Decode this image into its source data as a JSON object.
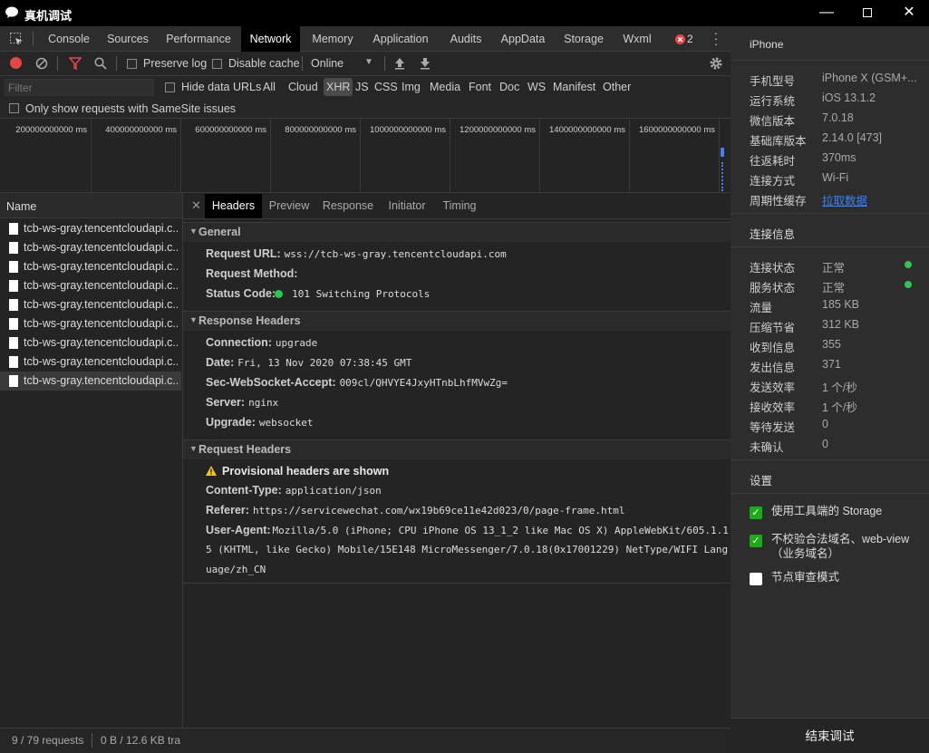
{
  "window": {
    "title": "真机调试"
  },
  "tabs": [
    "Console",
    "Sources",
    "Performance",
    "Network",
    "Memory",
    "Application",
    "Audits",
    "AppData",
    "Storage",
    "Wxml"
  ],
  "error_count": "2",
  "toolbar": {
    "preserve_log": "Preserve log",
    "disable_cache": "Disable cache",
    "throttle": "Online"
  },
  "filter": {
    "placeholder": "Filter",
    "hide_data_urls": "Hide data URLs",
    "types": [
      "All",
      "Cloud",
      "XHR",
      "JS",
      "CSS",
      "Img",
      "Media",
      "Font",
      "Doc",
      "WS",
      "Manifest",
      "Other"
    ],
    "samesite": "Only show requests with SameSite issues"
  },
  "timeline": {
    "ticks": [
      "200000000000 ms",
      "400000000000 ms",
      "600000000000 ms",
      "800000000000 ms",
      "1000000000000 ms",
      "1200000000000 ms",
      "1400000000000 ms",
      "1600000000000 ms"
    ]
  },
  "requests": {
    "header": "Name",
    "items": [
      "tcb-ws-gray.tencentcloudapi.c...",
      "tcb-ws-gray.tencentcloudapi.c...",
      "tcb-ws-gray.tencentcloudapi.c...",
      "tcb-ws-gray.tencentcloudapi.c...",
      "tcb-ws-gray.tencentcloudapi.c...",
      "tcb-ws-gray.tencentcloudapi.c...",
      "tcb-ws-gray.tencentcloudapi.c...",
      "tcb-ws-gray.tencentcloudapi.c...",
      "tcb-ws-gray.tencentcloudapi.c..."
    ]
  },
  "status": {
    "requests": "9 / 79 requests",
    "transferred": "0 B / 12.6 KB tra"
  },
  "detail": {
    "tabs": [
      "Headers",
      "Preview",
      "Response",
      "Initiator",
      "Timing"
    ],
    "general": {
      "title": "General",
      "request_url_label": "Request URL:",
      "request_url": "wss://tcb-ws-gray.tencentcloudapi.com",
      "request_method_label": "Request Method:",
      "status_code_label": "Status Code:",
      "status_code": "101 Switching Protocols"
    },
    "response_headers": {
      "title": "Response Headers",
      "items": [
        {
          "k": "Connection:",
          "v": "upgrade"
        },
        {
          "k": "Date:",
          "v": "Fri, 13 Nov 2020 07:38:45 GMT"
        },
        {
          "k": "Sec-WebSocket-Accept:",
          "v": "009cl/QHVYE4JxyHTnbLhfMVwZg="
        },
        {
          "k": "Server:",
          "v": "nginx"
        },
        {
          "k": "Upgrade:",
          "v": "websocket"
        }
      ]
    },
    "request_headers": {
      "title": "Request Headers",
      "warning": "Provisional headers are shown",
      "content_type_label": "Content-Type:",
      "content_type": "application/json",
      "referer_label": "Referer:",
      "referer": "https://servicewechat.com/wx19b69ce11e42d023/0/page-frame.html",
      "ua_label": "User-Agent:",
      "ua_line1": "Mozilla/5.0 (iPhone; CPU iPhone OS 13_1_2 like Mac OS X) AppleWebKit/605.1.1",
      "ua_line2": "5 (KHTML, like Gecko) Mobile/15E148 MicroMessenger/7.0.18(0x17001229) NetType/WIFI Lang",
      "ua_line3": "uage/zh_CN"
    }
  },
  "side": {
    "device_title": "iPhone",
    "device": [
      {
        "k": "手机型号",
        "v": "iPhone X (GSM+..."
      },
      {
        "k": "运行系统",
        "v": "iOS 13.1.2"
      },
      {
        "k": "微信版本",
        "v": "7.0.18"
      },
      {
        "k": "基础库版本",
        "v": "2.14.0 [473]"
      },
      {
        "k": "往返耗时",
        "v": "370ms"
      },
      {
        "k": "连接方式",
        "v": "Wi-Fi"
      },
      {
        "k": "周期性缓存",
        "v": "拉取数据"
      }
    ],
    "conn_title": "连接信息",
    "conn": [
      {
        "k": "连接状态",
        "v": "正常"
      },
      {
        "k": "服务状态",
        "v": "正常"
      },
      {
        "k": "流量",
        "v": "185 KB"
      },
      {
        "k": "压缩节省",
        "v": "312 KB"
      },
      {
        "k": "收到信息",
        "v": "355"
      },
      {
        "k": "发出信息",
        "v": "371"
      },
      {
        "k": "发送效率",
        "v": "1 个/秒"
      },
      {
        "k": "接收效率",
        "v": "1 个/秒"
      },
      {
        "k": "等待发送",
        "v": "0"
      },
      {
        "k": "未确认",
        "v": "0"
      }
    ],
    "settings_title": "设置",
    "settings": [
      "使用工具端的 Storage",
      "不校验合法域名、web-view（业务域名）",
      "节点审查模式"
    ],
    "end_button": "结束调试"
  },
  "colors": {
    "accent_green": "#1aad19",
    "status_green": "#2dc653",
    "record_red": "#e24646",
    "link_blue": "#3b82f6"
  }
}
